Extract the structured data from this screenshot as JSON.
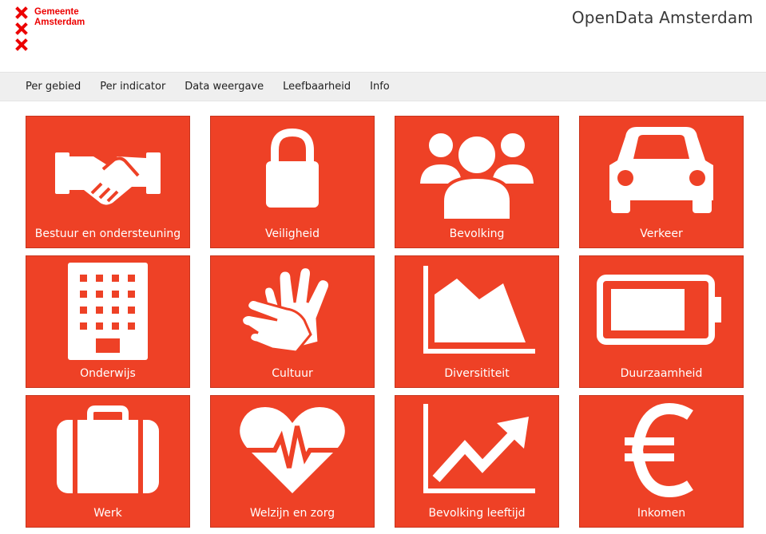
{
  "header": {
    "logo_line1": "Gemeente",
    "logo_line2": "Amsterdam",
    "title": "OpenData Amsterdam",
    "logo_color": "#ec0000"
  },
  "nav": {
    "items": [
      {
        "label": "Per gebied"
      },
      {
        "label": "Per indicator"
      },
      {
        "label": "Data weergave"
      },
      {
        "label": "Leefbaarheid"
      },
      {
        "label": "Info"
      }
    ]
  },
  "tiles": [
    {
      "label": "Bestuur en ondersteuning",
      "icon": "handshake-icon"
    },
    {
      "label": "Veiligheid",
      "icon": "lock-icon"
    },
    {
      "label": "Bevolking",
      "icon": "people-icon"
    },
    {
      "label": "Verkeer",
      "icon": "car-icon"
    },
    {
      "label": "Onderwijs",
      "icon": "building-icon"
    },
    {
      "label": "Cultuur",
      "icon": "clapping-hands-icon"
    },
    {
      "label": "Diversititeit",
      "icon": "area-chart-icon"
    },
    {
      "label": "Duurzaamheid",
      "icon": "battery-icon"
    },
    {
      "label": "Werk",
      "icon": "briefcase-icon"
    },
    {
      "label": "Welzijn en zorg",
      "icon": "heartbeat-icon"
    },
    {
      "label": "Bevolking leeftijd",
      "icon": "trend-up-icon"
    },
    {
      "label": "Inkomen",
      "icon": "euro-icon"
    }
  ],
  "colors": {
    "tile_background": "#ee4126",
    "nav_background": "#efefef"
  }
}
